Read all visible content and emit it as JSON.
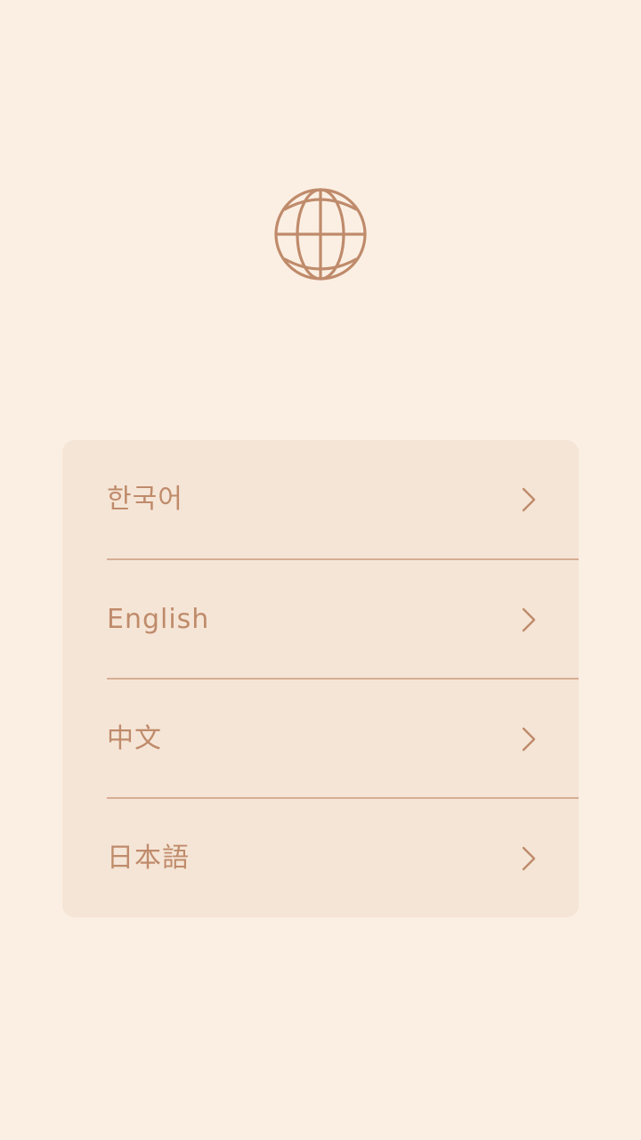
{
  "icons": {
    "globe": "globe-icon",
    "chevron": "chevron-right-icon"
  },
  "colors": {
    "background": "#FBEFE3",
    "card": "#F5E5D6",
    "accent": "#BF8B6B",
    "divider": "#D6AE94"
  },
  "languages": [
    {
      "label": "한국어"
    },
    {
      "label": "English"
    },
    {
      "label": "中文"
    },
    {
      "label": "日本語"
    }
  ]
}
